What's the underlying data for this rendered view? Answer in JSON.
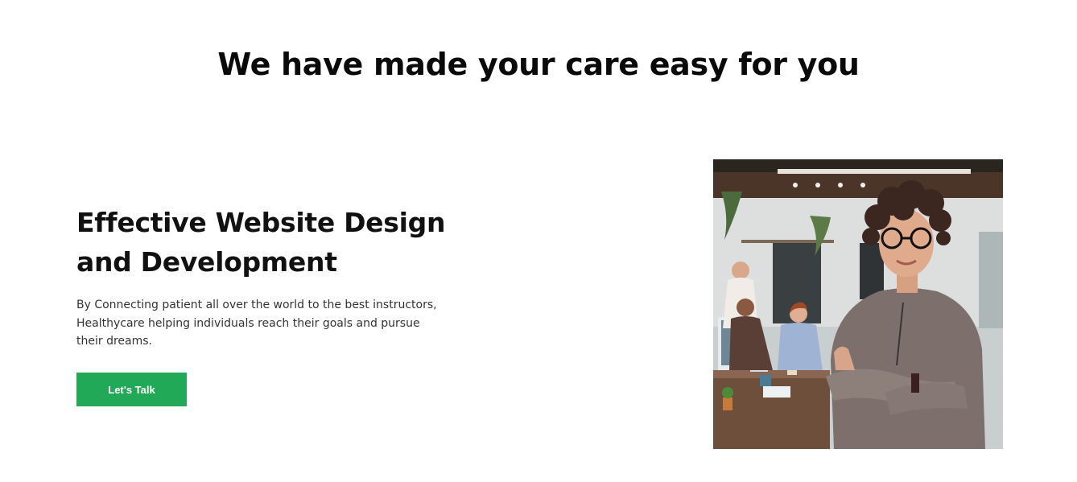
{
  "section": {
    "title": "We have made your care easy for you"
  },
  "feature": {
    "heading": "Effective Website Design and Development",
    "description": "By Connecting patient all over the world to the best instructors, Healthycare helping individuals reach their goals and pursue their dreams.",
    "cta_label": "Let's Talk"
  },
  "colors": {
    "accent": "#22a957",
    "heading": "#0a0a0a",
    "body_text": "#333333",
    "background": "#ffffff"
  }
}
